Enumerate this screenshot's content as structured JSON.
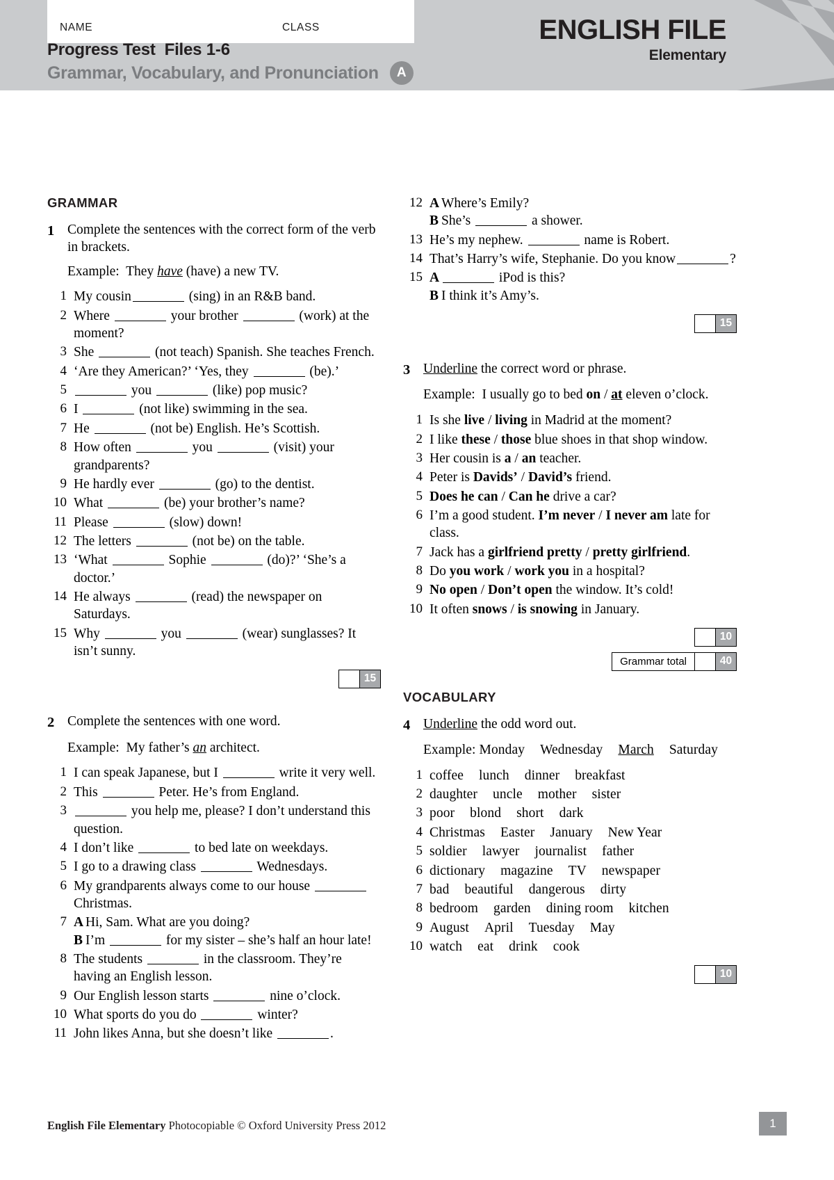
{
  "header": {
    "name_label": "NAME",
    "class_label": "CLASS",
    "title_line1": "Progress Test  Files 1-6",
    "title_line2": "Grammar, Vocabulary, and Pronunciation",
    "version_badge": "A",
    "brand_name": "ENGLISH FILE",
    "brand_level": "Elementary",
    "gray": "#c9cbcd"
  },
  "sections": {
    "grammar_heading": "GRAMMAR",
    "vocabulary_heading": "VOCABULARY"
  },
  "exercise1": {
    "number": "1",
    "rubric": "Complete the sentences with the correct form of the verb in brackets.",
    "example_prefix": "Example:",
    "example_text_a": "They ",
    "example_answer": "have",
    "example_text_b": " (have) a new TV.",
    "items": [
      {
        "n": "1",
        "text": "My cousin____ (sing) in an R&B band."
      },
      {
        "n": "2",
        "text": "Where ____ your brother ____ (work) at the moment?"
      },
      {
        "n": "3",
        "text": "She ____ (not teach) Spanish. She teaches French."
      },
      {
        "n": "4",
        "text": "‘Are they American?’   ‘Yes, they ____ (be).’"
      },
      {
        "n": "5",
        "text": "____ you ____ (like) pop music?"
      },
      {
        "n": "6",
        "text": "I ____ (not like) swimming in the sea."
      },
      {
        "n": "7",
        "text": "He ____ (not be) English. He’s Scottish."
      },
      {
        "n": "8",
        "text": "How often ____ you ____ (visit) your grandparents?"
      },
      {
        "n": "9",
        "text": "He hardly ever ____ (go) to the dentist."
      },
      {
        "n": "10",
        "text": "What ____ (be) your brother’s name?"
      },
      {
        "n": "11",
        "text": "Please ____ (slow) down!"
      },
      {
        "n": "12",
        "text": "The letters ____ (not be) on the table."
      },
      {
        "n": "13",
        "text": "‘What ____ Sophie ____ (do)?’   ‘She’s a doctor.’"
      },
      {
        "n": "14",
        "text": "He always ____ (read) the newspaper on Saturdays."
      },
      {
        "n": "15",
        "text": "Why ____ you ____ (wear) sunglasses? It isn’t sunny."
      }
    ],
    "score": "15"
  },
  "exercise2": {
    "number": "2",
    "rubric": "Complete the sentences with one word.",
    "example_prefix": "Example:",
    "example_text_a": "My father’s ",
    "example_answer": "an",
    "example_text_b": " architect.",
    "items": [
      {
        "n": "1",
        "text": "I can speak Japanese, but I ____ write it very well."
      },
      {
        "n": "2",
        "text": "This ____ Peter. He’s from England."
      },
      {
        "n": "3",
        "text": "____ you help me, please? I don’t understand this question."
      },
      {
        "n": "4",
        "text": "I don’t like ____ to bed late on weekdays."
      },
      {
        "n": "5",
        "text": "I go to a drawing class ____ Wednesdays."
      },
      {
        "n": "6",
        "text": "My grandparents always come to our house ____ Christmas."
      },
      {
        "n": "7",
        "dialogue": [
          {
            "speaker": "A",
            "text": "Hi, Sam. What are you doing?"
          },
          {
            "speaker": "B",
            "text": "I’m ____ for my sister – she’s half an hour late!"
          }
        ]
      },
      {
        "n": "8",
        "text": "The students ____ in the classroom. They’re having an English lesson."
      },
      {
        "n": "9",
        "text": "Our English lesson starts ____ nine o’clock."
      },
      {
        "n": "10",
        "text": "What sports do you do ____ winter?"
      },
      {
        "n": "11",
        "text": "John likes Anna, but she doesn’t like ____."
      },
      {
        "n": "12",
        "dialogue": [
          {
            "speaker": "A",
            "text": "Where’s Emily?"
          },
          {
            "speaker": "B",
            "text": "She’s ____ a shower."
          }
        ]
      },
      {
        "n": "13",
        "text": "He’s my nephew. ____ name is Robert."
      },
      {
        "n": "14",
        "text": "That’s Harry’s wife, Stephanie. Do you know____?"
      },
      {
        "n": "15",
        "dialogue": [
          {
            "speaker": "A",
            "text": "____ iPod is this?"
          },
          {
            "speaker": "B",
            "text": "I think it’s Amy’s."
          }
        ]
      }
    ],
    "score": "15"
  },
  "exercise3": {
    "number": "3",
    "rubric_underlined": "Underline",
    "rubric_rest": " the correct word or phrase.",
    "example_prefix": "Example:",
    "example": "I usually go to bed on / at eleven o’clock.",
    "items": [
      {
        "n": "1",
        "before": "Is she ",
        "a": "live",
        "b": "living",
        "after": " in Madrid at the moment?"
      },
      {
        "n": "2",
        "before": "I like ",
        "a": "these",
        "b": "those",
        "after": " blue shoes in that shop window."
      },
      {
        "n": "3",
        "before": "Her cousin is ",
        "a": "a",
        "b": "an",
        "after": " teacher."
      },
      {
        "n": "4",
        "before": "Peter is ",
        "a": "Davids’",
        "b": "David’s",
        "after": " friend."
      },
      {
        "n": "5",
        "before": "",
        "a": "Does he can",
        "b": "Can he",
        "after": " drive a car?"
      },
      {
        "n": "6",
        "before": "I’m a good student. ",
        "a": "I’m never",
        "b": "I never am",
        "after": " late for class."
      },
      {
        "n": "7",
        "before": "Jack has a ",
        "a": "girlfriend pretty",
        "b": "pretty girlfriend",
        "after": "."
      },
      {
        "n": "8",
        "before": "Do ",
        "a": "you work",
        "b": "work you",
        "after": " in a hospital?"
      },
      {
        "n": "9",
        "before": "",
        "a": "No open",
        "b": "Don’t open",
        "after": " the window. It’s cold!"
      },
      {
        "n": "10",
        "before": "It often ",
        "a": "snows",
        "b": "is snowing",
        "after": " in January."
      }
    ],
    "score": "10",
    "total_label": "Grammar total",
    "total_value": "40"
  },
  "exercise4": {
    "number": "4",
    "rubric_underlined": "Underline",
    "rubric_rest": " the odd word out.",
    "example_prefix": "Example:",
    "example_words": [
      "Monday",
      "Wednesday",
      "March",
      "Saturday"
    ],
    "example_answer_index": 2,
    "items": [
      {
        "n": "1",
        "words": [
          "coffee",
          "lunch",
          "dinner",
          "breakfast"
        ]
      },
      {
        "n": "2",
        "words": [
          "daughter",
          "uncle",
          "mother",
          "sister"
        ]
      },
      {
        "n": "3",
        "words": [
          "poor",
          "blond",
          "short",
          "dark"
        ]
      },
      {
        "n": "4",
        "words": [
          "Christmas",
          "Easter",
          "January",
          "New Year"
        ]
      },
      {
        "n": "5",
        "words": [
          "soldier",
          "lawyer",
          "journalist",
          "father"
        ]
      },
      {
        "n": "6",
        "words": [
          "dictionary",
          "magazine",
          "TV",
          "newspaper"
        ]
      },
      {
        "n": "7",
        "words": [
          "bad",
          "beautiful",
          "dangerous",
          "dirty"
        ]
      },
      {
        "n": "8",
        "words": [
          "bedroom",
          "garden",
          "dining room",
          "kitchen"
        ]
      },
      {
        "n": "9",
        "words": [
          "August",
          "April",
          "Tuesday",
          "May"
        ]
      },
      {
        "n": "10",
        "words": [
          "watch",
          "eat",
          "drink",
          "cook"
        ]
      }
    ],
    "score": "10"
  },
  "footer": {
    "publisher_bold": "English File Elementary",
    "publisher_rest": " Photocopiable © Oxford University Press 2012",
    "page_number": "1"
  }
}
